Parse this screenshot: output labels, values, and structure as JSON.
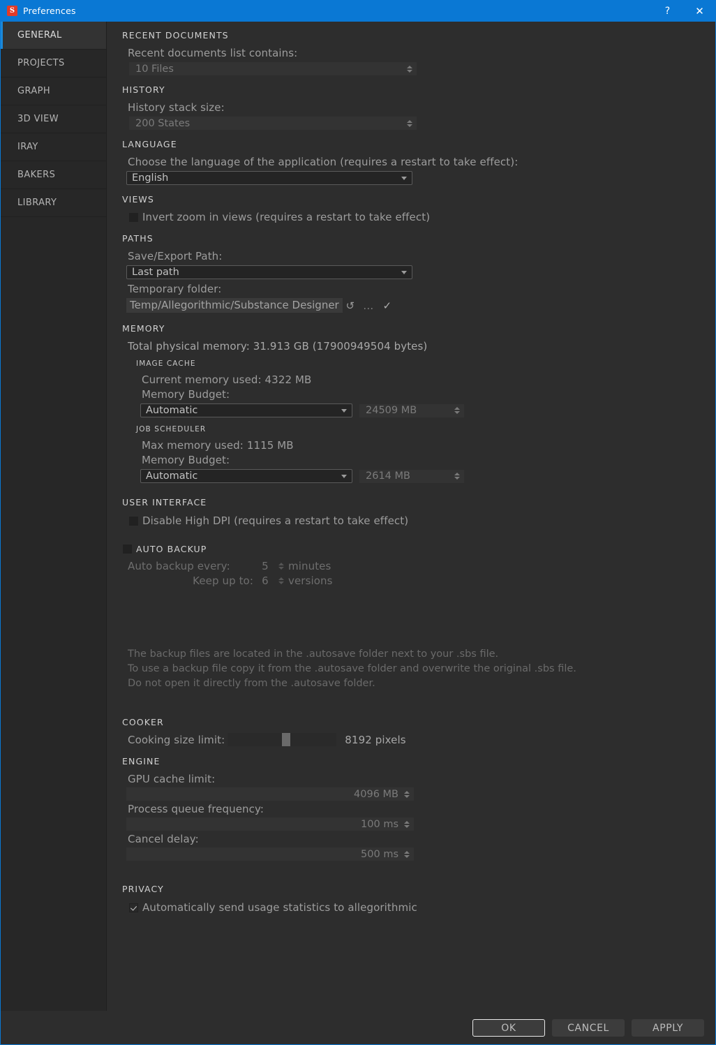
{
  "window": {
    "title": "Preferences",
    "app_icon": "S",
    "help_label": "?",
    "close_label": "✕",
    "accent_color": "#0a78d4"
  },
  "sidebar": {
    "items": [
      {
        "label": "GENERAL",
        "active": true
      },
      {
        "label": "PROJECTS",
        "active": false
      },
      {
        "label": "GRAPH",
        "active": false
      },
      {
        "label": "3D VIEW",
        "active": false
      },
      {
        "label": "IRAY",
        "active": false
      },
      {
        "label": "BAKERS",
        "active": false
      },
      {
        "label": "LIBRARY",
        "active": false
      }
    ]
  },
  "sections": {
    "recent_documents": {
      "title": "RECENT DOCUMENTS",
      "label": "Recent documents list contains:",
      "value": "10 Files"
    },
    "history": {
      "title": "HISTORY",
      "label": "History stack size:",
      "value": "200 States"
    },
    "language": {
      "title": "LANGUAGE",
      "label": "Choose the language of the application (requires a restart to take effect):",
      "value": "English"
    },
    "views": {
      "title": "VIEWS",
      "invert_zoom_label": "Invert zoom in views (requires a restart to take effect)",
      "invert_zoom_checked": false
    },
    "paths": {
      "title": "PATHS",
      "save_export_label": "Save/Export Path:",
      "save_export_value": "Last path",
      "temp_folder_label": "Temporary folder:",
      "temp_folder_value": "Temp/Allegorithmic/Substance Designer",
      "reset_icon": "↺",
      "browse_label": "…",
      "confirm_icon": "✓"
    },
    "memory": {
      "title": "MEMORY",
      "total_physical": "Total physical memory: 31.913 GB (17900949504 bytes)",
      "image_cache": {
        "title": "IMAGE CACHE",
        "current_used": "Current memory used: 4322 MB",
        "budget_label": "Memory Budget:",
        "budget_mode": "Automatic",
        "budget_value": "24509 MB"
      },
      "job_scheduler": {
        "title": "JOB SCHEDULER",
        "max_used": "Max memory used: 1115 MB",
        "budget_label": "Memory Budget:",
        "budget_mode": "Automatic",
        "budget_value": "2614 MB"
      }
    },
    "user_interface": {
      "title": "USER INTERFACE",
      "disable_dpi_label": "Disable High DPI (requires a restart to take effect)",
      "disable_dpi_checked": false
    },
    "auto_backup": {
      "title": "AUTO BACKUP",
      "enabled": false,
      "every_label": "Auto backup every:",
      "every_value": "5",
      "every_unit": "minutes",
      "keep_label": "Keep up to:",
      "keep_value": "6",
      "keep_unit": "versions",
      "info_line1": "The backup files are located in the .autosave folder next to your .sbs file.",
      "info_line2": "To use a backup file copy it from the .autosave folder and overwrite the original .sbs file.",
      "info_line3": "Do not open it directly from the .autosave folder."
    },
    "cooker": {
      "title": "COOKER",
      "size_limit_label": "Cooking size limit:",
      "size_limit_value": "8192 pixels"
    },
    "engine": {
      "title": "ENGINE",
      "gpu_cache_label": "GPU cache limit:",
      "gpu_cache_value": "4096 MB",
      "queue_freq_label": "Process queue frequency:",
      "queue_freq_value": "100 ms",
      "cancel_delay_label": "Cancel delay:",
      "cancel_delay_value": "500 ms"
    },
    "privacy": {
      "title": "PRIVACY",
      "usage_stats_label": "Automatically send usage statistics to allegorithmic",
      "usage_stats_checked": true
    }
  },
  "footer": {
    "ok": "OK",
    "cancel": "CANCEL",
    "apply": "APPLY"
  }
}
